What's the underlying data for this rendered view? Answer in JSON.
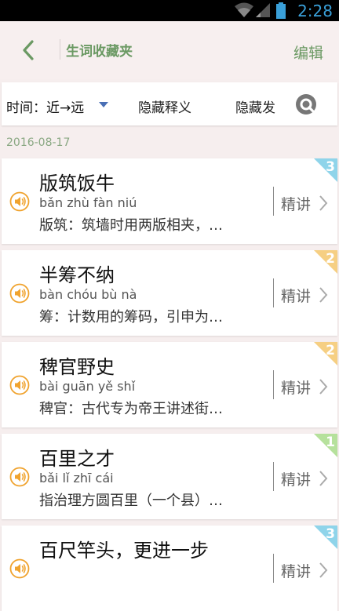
{
  "status": {
    "time": "2:28"
  },
  "header": {
    "title": "生词收藏夹",
    "edit_label": "编辑"
  },
  "filter": {
    "sort_label": "时间：近→远",
    "hide_definition": "隐藏释义",
    "hide_pronunciation": "隐藏发"
  },
  "date_group": "2016-08-17",
  "detail_label": "精讲",
  "words": [
    {
      "word": "版筑饭牛",
      "pinyin": "bǎn zhù fàn niú",
      "meaning": "版筑：筑墙时用两版相夹，…",
      "badge": "3",
      "badge_color": "#8fd4ea"
    },
    {
      "word": "半筹不纳",
      "pinyin": "bàn chóu bù nà",
      "meaning": "筹：计数用的筹码，引申为…",
      "badge": "2",
      "badge_color": "#f6cf83"
    },
    {
      "word": "稗官野史",
      "pinyin": "bài guān yě shǐ",
      "meaning": "稗官：古代专为帝王讲述街…",
      "badge": "2",
      "badge_color": "#f6cf83"
    },
    {
      "word": "百里之才",
      "pinyin": "bǎi lǐ zhī cái",
      "meaning": "指治理方圆百里（一个县）…",
      "badge": "1",
      "badge_color": "#b6e19c"
    },
    {
      "word": "百尺竿头，更进一步",
      "pinyin": "",
      "meaning": "",
      "badge": "3",
      "badge_color": "#8fd4ea"
    }
  ]
}
